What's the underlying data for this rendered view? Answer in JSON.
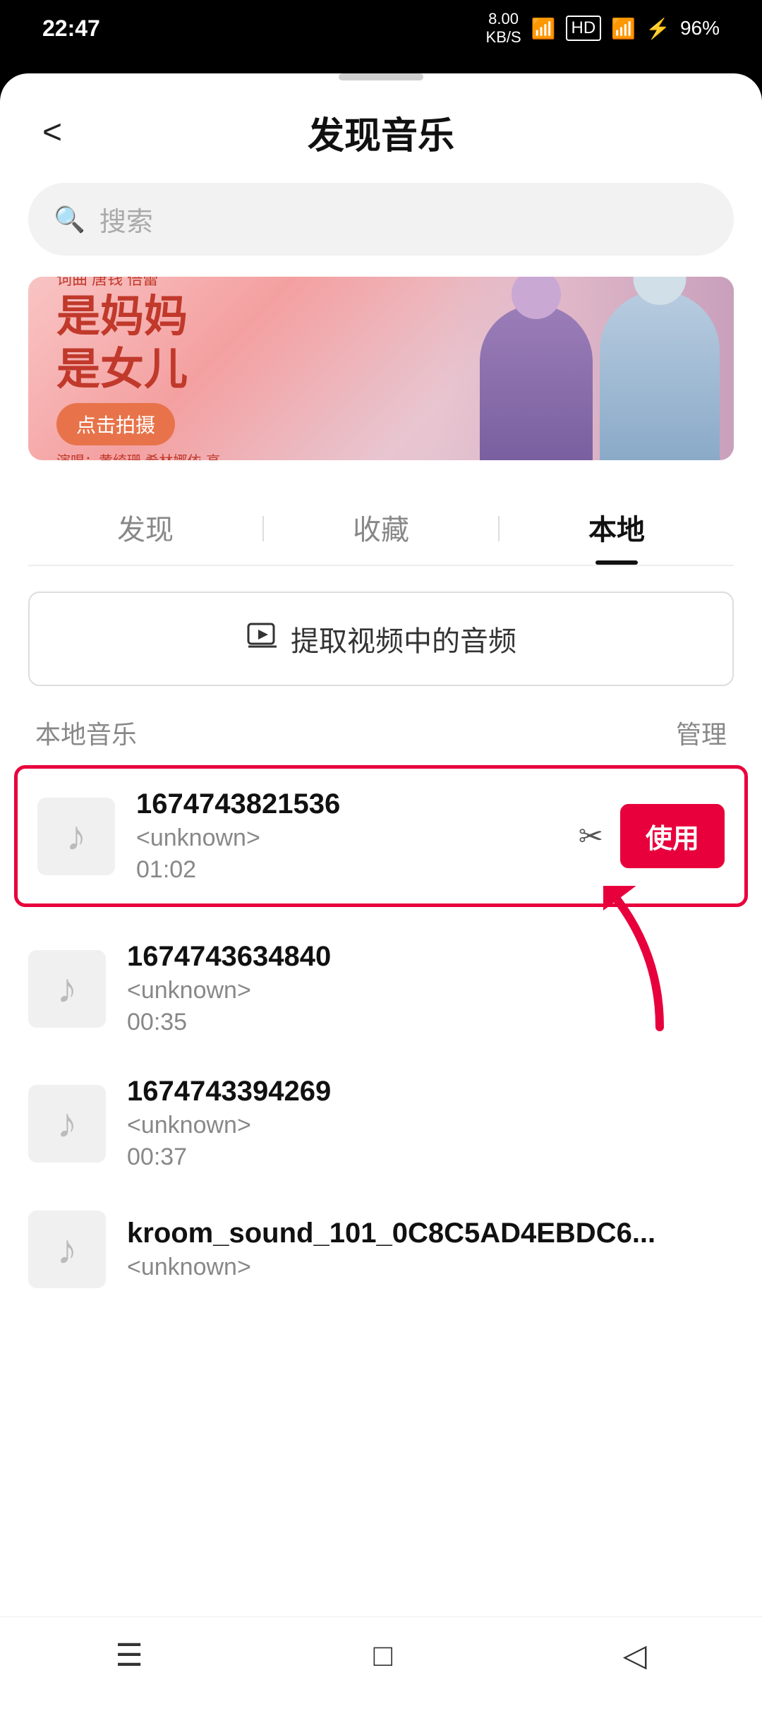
{
  "statusBar": {
    "time": "22:47",
    "speed": "8.00\nKB/S",
    "battery": "96%"
  },
  "header": {
    "backLabel": "<",
    "title": "发现音乐"
  },
  "search": {
    "placeholder": "搜索"
  },
  "banner": {
    "line1": "是妈妈",
    "line2": "是女儿",
    "topLabel": "词曲\n唐钱\n倍蕾",
    "btn": "点击拍摄",
    "credit": "演唱：黄绮珊 希林娜依·高"
  },
  "tabs": [
    {
      "label": "发现",
      "active": false
    },
    {
      "label": "收藏",
      "active": false
    },
    {
      "label": "本地",
      "active": true
    }
  ],
  "extractBtn": {
    "label": "提取视频中的音频"
  },
  "sectionTitle": "本地音乐",
  "manageLabel": "管理",
  "musicList": [
    {
      "name": "1674743821536",
      "artist": "<unknown>",
      "duration": "01:02",
      "highlighted": true,
      "showUse": true
    },
    {
      "name": "1674743634840",
      "artist": "<unknown>",
      "duration": "00:35",
      "highlighted": false,
      "showUse": false
    },
    {
      "name": "1674743394269",
      "artist": "<unknown>",
      "duration": "00:37",
      "highlighted": false,
      "showUse": false
    },
    {
      "name": "kroom_sound_101_0C8C5AD4EBDC6...",
      "artist": "<unknown>",
      "duration": "",
      "highlighted": false,
      "showUse": false
    }
  ],
  "useButtonLabel": "使用",
  "nav": {
    "menu": "☰",
    "home": "□",
    "back": "◁"
  }
}
